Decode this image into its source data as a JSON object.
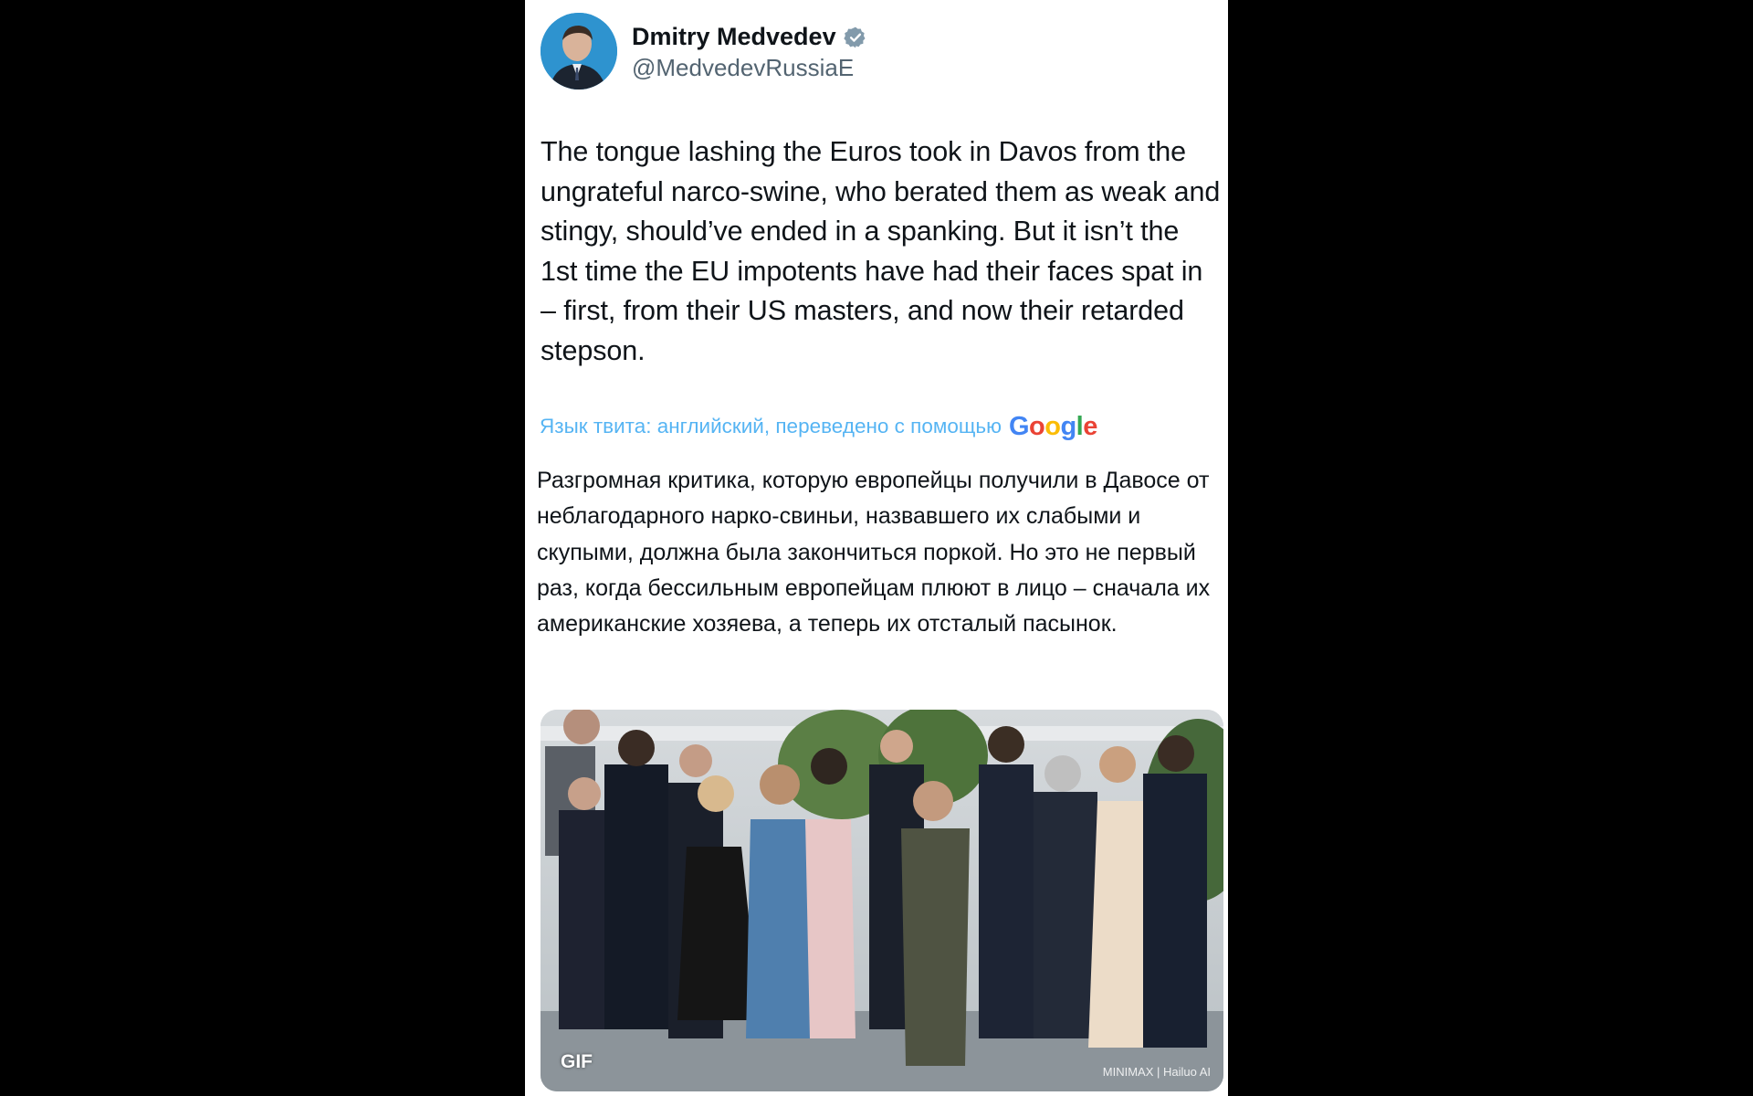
{
  "tweet": {
    "author": {
      "display_name": "Dmitry Medvedev",
      "handle": "@MedvedevRussiaE",
      "verified_icon": "verified-badge-icon",
      "verified_color": "#829aab"
    },
    "text": "The tongue lashing the Euros took in Davos from the ungrateful narco-swine, who berated them as weak and stingy, should’ve ended in a spanking. But it isn’t the 1st time the EU impotents have had their faces spat in – first, from their US masters, and now their retarded stepson.",
    "translation": {
      "label": "Язык твита: английский, переведено с помощью",
      "provider_logo": "Google",
      "text": "Разгромная критика, которую европейцы получили в Давосе от неблагодарного нарко-свиньи, назвавшего их слабыми и скупыми, должна была закончиться поркой. Но это не первый раз, когда бессильным европейцам плюют в лицо – сначала их американские хозяева, а теперь их отсталый пасынок."
    },
    "media": {
      "badge": "GIF",
      "watermark": "MINIMAX | Hailuo AI"
    }
  },
  "colors": {
    "background": "#000000",
    "card": "#ffffff",
    "text": "#0f1419",
    "secondary_text": "#536471",
    "link": "#1d9bf0"
  }
}
